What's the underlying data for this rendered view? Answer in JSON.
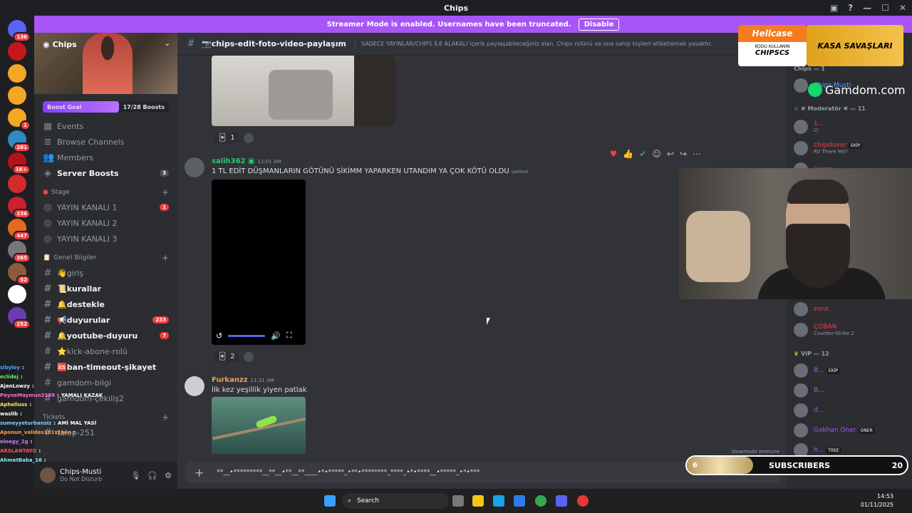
{
  "window": {
    "title": "Chips"
  },
  "banner": {
    "text": "Streamer Mode is enabled. Usernames have been truncated.",
    "button": "Disable"
  },
  "servers": [
    {
      "badge": "136",
      "color": "#5865f2"
    },
    {
      "badge": "",
      "color": "#c4161c"
    },
    {
      "badge": "",
      "color": "#f5a623"
    },
    {
      "badge": "",
      "color": "#f5a623"
    },
    {
      "badge": "1",
      "color": "#f5a623"
    },
    {
      "badge": "281",
      "color": "#2f8ac6"
    },
    {
      "badge": "1K+",
      "color": "#b3131a"
    },
    {
      "badge": "",
      "color": "#d22b2b"
    },
    {
      "badge": "236",
      "color": "#c9212f"
    },
    {
      "badge": "447",
      "color": "#e36a1c"
    },
    {
      "badge": "365",
      "color": "#777777"
    },
    {
      "badge": "52",
      "color": "#8e5b3c"
    },
    {
      "badge": "",
      "color": "#ffffff"
    },
    {
      "badge": "252",
      "color": "#6c3bb0"
    }
  ],
  "server": {
    "name": "Chips",
    "boost_goal": "Boost Goal",
    "boost_count": "17/28 Boosts",
    "boost_fraction": 0.607,
    "menu": [
      {
        "label": "Events"
      },
      {
        "label": "Browse Channels"
      },
      {
        "label": "Members"
      },
      {
        "label": "Server Boosts",
        "count": "3"
      }
    ],
    "stage_category": "Stage",
    "stage_channels": [
      {
        "label": "YAYIN KANALI 1",
        "count": "1"
      },
      {
        "label": "YAYIN KANALI 2"
      },
      {
        "label": "YAYIN KANALI 3"
      }
    ],
    "info_category": "Genel Bilgiler",
    "channels": [
      {
        "label": "👋giriş",
        "bold": false
      },
      {
        "label": "📜kurallar",
        "bold": true
      },
      {
        "label": "🔔destekle",
        "bold": true
      },
      {
        "label": "📢duyurular",
        "bold": true,
        "count": "233"
      },
      {
        "label": "🔔youtube-duyuru",
        "bold": true,
        "count": "7"
      },
      {
        "label": "⭐kick-abone-rolü",
        "bold": false
      },
      {
        "label": "🆘ban-timeout-şikayet",
        "bold": true
      },
      {
        "label": "gamdom-bilgi",
        "bold": false
      },
      {
        "label": "gamdom-çekiliş2",
        "bold": false
      }
    ],
    "tickets_category": "Tickets",
    "ticket_channel": "talep-251"
  },
  "user": {
    "name": "Chips-Musti",
    "status": "Do Not Disturb"
  },
  "channel": {
    "name": "📷chips-edit-foto-video-paylaşım",
    "topic": "SADECE YAYINLAR/CHIPS İLE ALAKALI içerik paylaşabileceğiniz alan. Chips rolünü ve ona sahip kişileri etiketlemek yasaktır."
  },
  "messages": [
    {
      "reaction_count": "1"
    },
    {
      "author": "salih362",
      "time": "11:01 AM",
      "text": "1 TL EDİT DÜŞMANLARIN GÖTÜNÜ SİKİMM YAPARKEN UTANDIM YA ÇOK KÖTÜ OLDU",
      "edited": "(edited)",
      "reaction_count": "2",
      "author_color": "#2dc770"
    },
    {
      "author": "Furkanzz",
      "time": "11:31 AM",
      "text": "İlk kez yeşillik yiyen patlak",
      "author_color": "#e3a35b"
    }
  ],
  "composer": {
    "text": "**__•*********__**__•**__**____•*•*****_•**•********_****_•*•****__•*****_•*•***",
    "slowmode": "Slowmode Immune"
  },
  "members": {
    "group_chips": "Chips — 1",
    "chips_member": "Chips-Musti",
    "group_mod": "✖ Moderatör ✖ — 11",
    "mods": [
      {
        "name": "1...",
        "sub": "☑"
      },
      {
        "name": "chipslover",
        "sub": "RV There Yet?",
        "tag": "EKİP"
      },
      {
        "name": "kairos",
        "sub": ""
      }
    ],
    "others": [
      {
        "name": "zonz",
        "sub": ""
      },
      {
        "name": "ÇOBAN",
        "sub": "Counter-Strike 2"
      }
    ],
    "group_vip": "VIP — 12",
    "vips": [
      {
        "name": "B...",
        "tag": "EKİP"
      },
      {
        "name": "B..."
      },
      {
        "name": "d..."
      },
      {
        "name": "Gokhan Oner",
        "tag": "ONER"
      },
      {
        "name": "h...",
        "tag": "TREE"
      }
    ]
  },
  "ads": {
    "hellcase": "Hellcase",
    "hellcase_line": "KODU KULLANIN",
    "hellcase_code": "CHIPSCS",
    "kasa": "KASA SAVAŞLARI",
    "gamdom": "Gamdom.com"
  },
  "chat_overlay": [
    {
      "user": "sibyloy",
      "msg": "",
      "color": "#54a3ff"
    },
    {
      "user": "eclidej",
      "msg": "",
      "color": "#5df26d"
    },
    {
      "user": "AjanLowzy",
      "msg": "",
      "color": "#ffffff"
    },
    {
      "user": "PeyneMaymun3169",
      "msg": "YAMALI KAZAK",
      "color": "#ff6ad5"
    },
    {
      "user": "Aphelluss",
      "msg": "",
      "color": "#ffe261"
    },
    {
      "user": "waslib",
      "msg": "",
      "color": "#ffffff"
    },
    {
      "user": "sumeyyeturbansiz",
      "msg": "AMİ MAL YASİ",
      "color": "#8ec9ff"
    },
    {
      "user": "Aponun_valides1n1s1ken",
      "msg": "",
      "color": "#ff9f43"
    },
    {
      "user": "eloegy_2g",
      "msg": "",
      "color": "#c77dff"
    },
    {
      "user": "ARSLANTAYO",
      "msg": "",
      "color": "#ff5555"
    },
    {
      "user": "AhmetBaba_16",
      "msg": "",
      "color": "#7cf0ff"
    }
  ],
  "subs": {
    "current": "6",
    "label": "SUBSCRIBERS",
    "goal": "20",
    "fraction": 0.3
  },
  "taskbar": {
    "search": "Search",
    "time": "14:53",
    "date": "01/11/2025"
  }
}
